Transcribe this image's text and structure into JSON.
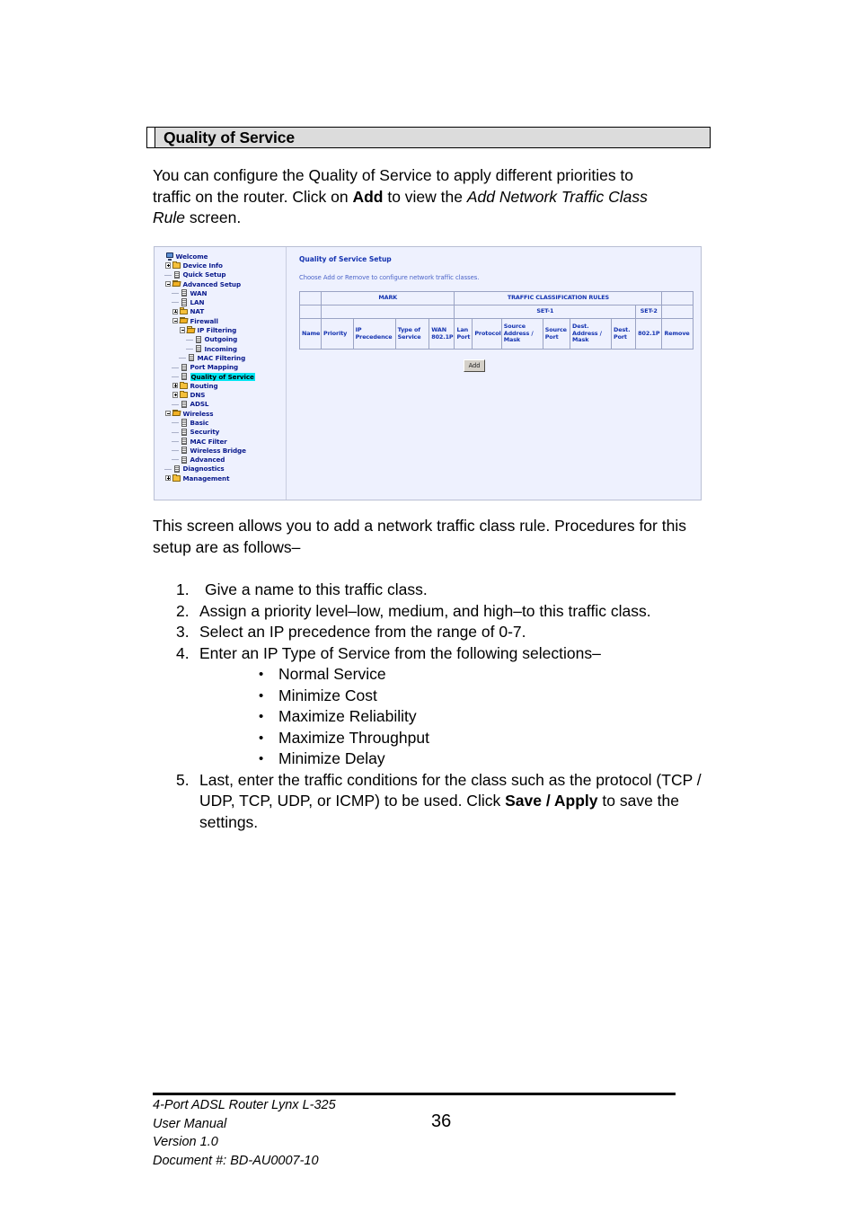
{
  "document": {
    "section_heading": "Quality of Service",
    "intro_paragraph": {
      "part1": "You can configure the Quality of Service to apply different priorities to traffic on the router.  Click on ",
      "bold1": "Add",
      "part2": " to view the ",
      "italic1": "Add Network Traffic Class Rule",
      "part3": " screen."
    },
    "description_paragraph": "This screen allows you to add a network traffic class rule. Procedures for this setup are as follows–",
    "steps": [
      {
        "num": "1.",
        "text": "Give a name to this traffic class."
      },
      {
        "num": "2.",
        "text": "Assign a priority level–low, medium, and high–to this traffic class."
      },
      {
        "num": "3.",
        "text": "Select an IP precedence from the range of 0-7."
      },
      {
        "num": "4.",
        "text": "Enter an IP Type of Service from the following selections–"
      }
    ],
    "tos_options": [
      "Normal Service",
      "Minimize Cost",
      "Maximize Reliability",
      "Maximize Throughput",
      "Minimize Delay"
    ],
    "final_step": {
      "num": "5.",
      "part1": "Last, enter the traffic conditions for the class such as the protocol (TCP / UDP, TCP, UDP, or ICMP) to be used. Click ",
      "bold1": "Save / Apply",
      "part2": " to save the settings."
    },
    "footer": {
      "line1": "4-Port ADSL Router Lynx L-325",
      "line2": "User Manual",
      "line3": "Version 1.0",
      "line4": "Document #:  BD-AU0007-10",
      "page_number": "36"
    }
  },
  "screenshot": {
    "tree": [
      {
        "label": "Welcome",
        "depth": 0,
        "expander": "none",
        "icon": "monitor-icon",
        "selected": false
      },
      {
        "label": "Device Info",
        "depth": 1,
        "expander": "plus",
        "icon": "folder-icon",
        "selected": false
      },
      {
        "label": "Quick Setup",
        "depth": 1,
        "expander": "dash",
        "icon": "page-icon",
        "selected": false
      },
      {
        "label": "Advanced Setup",
        "depth": 1,
        "expander": "minus",
        "icon": "folder-open-icon",
        "selected": false
      },
      {
        "label": "WAN",
        "depth": 2,
        "expander": "dash",
        "icon": "page-icon",
        "selected": false
      },
      {
        "label": "LAN",
        "depth": 2,
        "expander": "dash",
        "icon": "page-icon",
        "selected": false
      },
      {
        "label": "NAT",
        "depth": 2,
        "expander": "plus",
        "icon": "folder-icon",
        "selected": false
      },
      {
        "label": "Firewall",
        "depth": 2,
        "expander": "minus",
        "icon": "folder-open-icon",
        "selected": false
      },
      {
        "label": "IP Filtering",
        "depth": 3,
        "expander": "minus",
        "icon": "folder-open-icon",
        "selected": false
      },
      {
        "label": "Outgoing",
        "depth": 4,
        "expander": "dash",
        "icon": "page-icon",
        "selected": false
      },
      {
        "label": "Incoming",
        "depth": 4,
        "expander": "dash",
        "icon": "page-icon",
        "selected": false
      },
      {
        "label": "MAC Filtering",
        "depth": 3,
        "expander": "dash",
        "icon": "page-icon",
        "selected": false
      },
      {
        "label": "Port Mapping",
        "depth": 2,
        "expander": "dash",
        "icon": "page-icon",
        "selected": false
      },
      {
        "label": "Quality of Service",
        "depth": 2,
        "expander": "dash",
        "icon": "page-icon",
        "selected": true
      },
      {
        "label": "Routing",
        "depth": 2,
        "expander": "plus",
        "icon": "folder-icon",
        "selected": false
      },
      {
        "label": "DNS",
        "depth": 2,
        "expander": "plus",
        "icon": "folder-icon",
        "selected": false
      },
      {
        "label": "ADSL",
        "depth": 2,
        "expander": "dash",
        "icon": "page-icon",
        "selected": false
      },
      {
        "label": "Wireless",
        "depth": 1,
        "expander": "minus",
        "icon": "folder-open-icon",
        "selected": false
      },
      {
        "label": "Basic",
        "depth": 2,
        "expander": "dash",
        "icon": "page-icon",
        "selected": false
      },
      {
        "label": "Security",
        "depth": 2,
        "expander": "dash",
        "icon": "page-icon",
        "selected": false
      },
      {
        "label": "MAC Filter",
        "depth": 2,
        "expander": "dash",
        "icon": "page-icon",
        "selected": false
      },
      {
        "label": "Wireless Bridge",
        "depth": 2,
        "expander": "dash",
        "icon": "page-icon",
        "selected": false
      },
      {
        "label": "Advanced",
        "depth": 2,
        "expander": "dash",
        "icon": "page-icon",
        "selected": false
      },
      {
        "label": "Diagnostics",
        "depth": 1,
        "expander": "dash",
        "icon": "page-icon",
        "selected": false
      },
      {
        "label": "Management",
        "depth": 1,
        "expander": "plus",
        "icon": "folder-icon",
        "selected": false
      }
    ],
    "panel": {
      "title": "Quality of Service Setup",
      "subtitle": "Choose Add or Remove to configure network traffic classes.",
      "add_button": "Add"
    },
    "table": {
      "group_row": [
        "",
        "MARK",
        "TRAFFIC CLASSIFICATION RULES",
        ""
      ],
      "set_row": [
        "",
        "",
        "SET-1",
        "SET-2",
        ""
      ],
      "columns": [
        "Name",
        "Priority",
        "IP Precedence",
        "Type of Service",
        "WAN 802.1P",
        "Lan Port",
        "Protocol",
        "Source Address / Mask",
        "Source Port",
        "Dest. Address / Mask",
        "Dest. Port",
        "802.1P",
        "Remove"
      ]
    },
    "colors": {
      "panel_bg": "#eef1fe",
      "text_blue": "#1433b0",
      "selected_highlight": "#00e5f2",
      "table_border": "#9aa3c4"
    }
  }
}
